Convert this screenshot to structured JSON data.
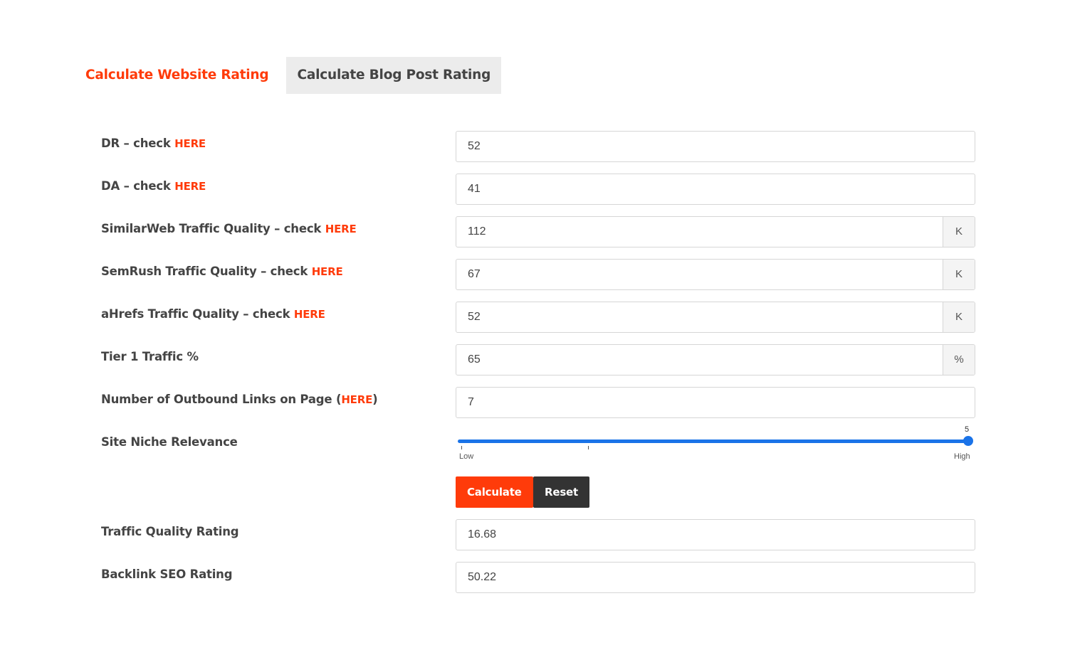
{
  "tabs": {
    "website": "Calculate Website Rating",
    "blog": "Calculate Blog Post Rating"
  },
  "fields": [
    {
      "label": "DR – check ",
      "link": "HERE",
      "value": "52"
    },
    {
      "label": "DA – check ",
      "link": "HERE",
      "value": "41"
    },
    {
      "label": "SimilarWeb Traffic Quality – check ",
      "link": "HERE",
      "value": "112",
      "suffix": "K"
    },
    {
      "label": "SemRush Traffic Quality – check ",
      "link": "HERE",
      "value": "67",
      "suffix": "K"
    },
    {
      "label": "aHrefs Traffic Quality – check ",
      "link": "HERE",
      "value": "52",
      "suffix": "K"
    },
    {
      "label": "Tier 1 Traffic %",
      "value": "65",
      "suffix": "%"
    },
    {
      "label": "Number of Outbound Links on Page (",
      "link": "HERE",
      "label_end": ")",
      "value": "7"
    }
  ],
  "slider": {
    "label": "Site Niche Relevance",
    "value": "5",
    "value_fraction": 1.0,
    "low_label": "Low",
    "high_label": "High"
  },
  "buttons": {
    "calculate": "Calculate",
    "reset": "Reset"
  },
  "results": [
    {
      "label": "Traffic Quality Rating",
      "value": "16.68"
    },
    {
      "label": "Backlink SEO Rating",
      "value": "50.22"
    }
  ],
  "colors": {
    "accent": "#ff3b0a",
    "slider": "#1a73e8",
    "reset_button": "#333333",
    "inactive_tab": "#ececec"
  }
}
